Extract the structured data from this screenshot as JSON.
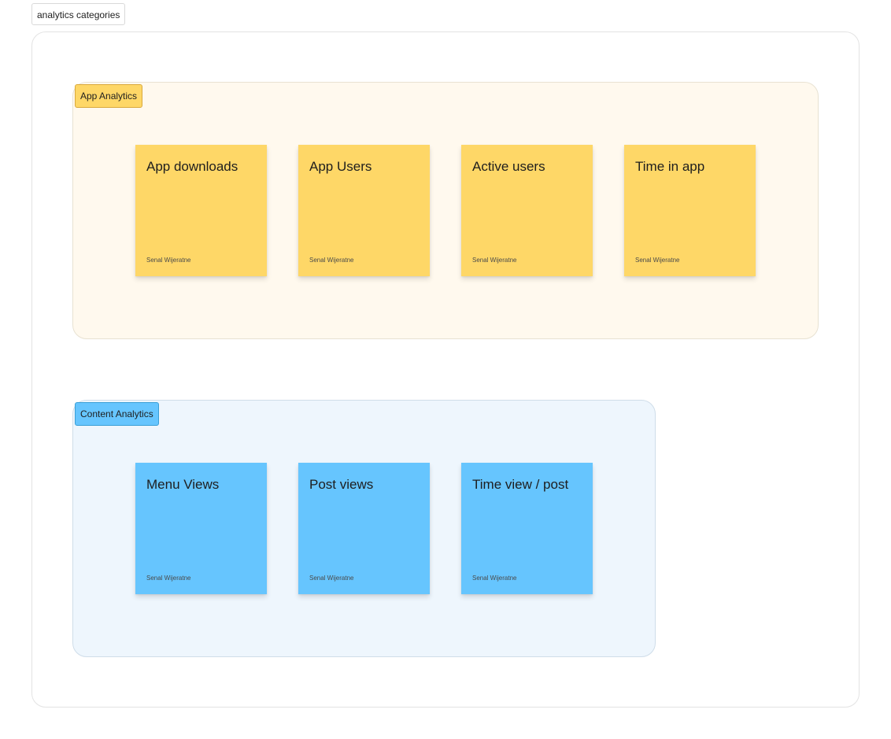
{
  "frame": {
    "label": "analytics categories"
  },
  "sections": [
    {
      "label": "App Analytics",
      "color": "#fed767",
      "notes": [
        {
          "title": "App downloads",
          "author": "Senal Wijeratne"
        },
        {
          "title": "App Users",
          "author": "Senal Wijeratne"
        },
        {
          "title": "Active users",
          "author": "Senal Wijeratne"
        },
        {
          "title": "Time in app",
          "author": "Senal Wijeratne"
        }
      ]
    },
    {
      "label": "Content Analytics",
      "color": "#66c5fe",
      "notes": [
        {
          "title": "Menu Views",
          "author": "Senal Wijeratne"
        },
        {
          "title": "Post views",
          "author": "Senal Wijeratne"
        },
        {
          "title": "Time view / post",
          "author": "Senal Wijeratne"
        }
      ]
    }
  ]
}
